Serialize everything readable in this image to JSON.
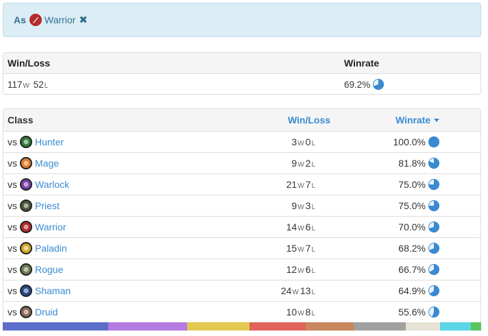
{
  "filter": {
    "as_label": "As",
    "class_name": "Warrior",
    "remove_icon": "times-icon"
  },
  "summary": {
    "headers": {
      "winloss": "Win/Loss",
      "winrate": "Winrate"
    },
    "wins": "117",
    "w_suffix": "W",
    "losses": "52",
    "l_suffix": "L",
    "winrate": "69.2%",
    "winrate_value": 0.692
  },
  "table": {
    "headers": {
      "class": "Class",
      "winloss": "Win/Loss",
      "winrate": "Winrate"
    },
    "vs_label": "vs",
    "rows": [
      {
        "icon": "hunter-icon",
        "icon_color": "#2f7d3a",
        "name": "Hunter",
        "wins": "3",
        "losses": "0",
        "winrate": "100.0%",
        "winrate_value": 1.0
      },
      {
        "icon": "mage-icon",
        "icon_color": "#e07b2c",
        "name": "Mage",
        "wins": "9",
        "losses": "2",
        "winrate": "81.8%",
        "winrate_value": 0.818
      },
      {
        "icon": "warlock-icon",
        "icon_color": "#7a3fa8",
        "name": "Warlock",
        "wins": "21",
        "losses": "7",
        "winrate": "75.0%",
        "winrate_value": 0.75
      },
      {
        "icon": "priest-icon",
        "icon_color": "#4b5a3a",
        "name": "Priest",
        "wins": "9",
        "losses": "3",
        "winrate": "75.0%",
        "winrate_value": 0.75
      },
      {
        "icon": "warrior-icon",
        "icon_color": "#b52a2a",
        "name": "Warrior",
        "wins": "14",
        "losses": "6",
        "winrate": "70.0%",
        "winrate_value": 0.7
      },
      {
        "icon": "paladin-icon",
        "icon_color": "#d4a82c",
        "name": "Paladin",
        "wins": "15",
        "losses": "7",
        "winrate": "68.2%",
        "winrate_value": 0.682
      },
      {
        "icon": "rogue-icon",
        "icon_color": "#6e7a52",
        "name": "Rogue",
        "wins": "12",
        "losses": "6",
        "winrate": "66.7%",
        "winrate_value": 0.667
      },
      {
        "icon": "shaman-icon",
        "icon_color": "#2a4a8a",
        "name": "Shaman",
        "wins": "24",
        "losses": "13",
        "winrate": "64.9%",
        "winrate_value": 0.649
      },
      {
        "icon": "druid-icon",
        "icon_color": "#8a6a5a",
        "name": "Druid",
        "wins": "10",
        "losses": "8",
        "winrate": "55.6%",
        "winrate_value": 0.556
      }
    ]
  },
  "colors": {
    "accent": "#3a8ad1",
    "pie": "#3a8ad1",
    "strip": [
      "#5b6ec9",
      "#b47be0",
      "#e2c850",
      "#e0645a",
      "#c8875c",
      "#a0a0a0",
      "#e6e2d6",
      "#5bd5e6",
      "#5cc45a"
    ],
    "strip_weights": [
      154,
      115,
      91,
      82,
      70,
      76,
      50,
      45,
      15
    ]
  },
  "pie_icon": "pie-chart-icon",
  "sort_icon": "caret-down-icon"
}
